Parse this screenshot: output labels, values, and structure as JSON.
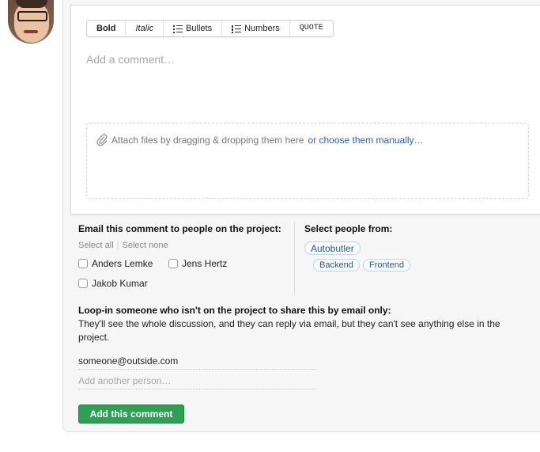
{
  "toolbar": {
    "bold": "Bold",
    "italic": "Italic",
    "bullets": "Bullets",
    "numbers": "Numbers",
    "quote": "QUOTE"
  },
  "editor": {
    "placeholder": "Add a comment…",
    "attach_text": "Attach files by dragging & dropping them here",
    "attach_link": "or choose them manually…"
  },
  "email_section": {
    "heading": "Email this comment to people on the project:",
    "select_all": "Select all",
    "select_none": "Select none",
    "people": [
      {
        "name": "Anders Lemke",
        "checked": false
      },
      {
        "name": "Jens Hertz",
        "checked": false
      },
      {
        "name": "Jakob Kumar",
        "checked": false
      }
    ]
  },
  "select_from": {
    "heading": "Select people from:",
    "groups": [
      "Autobutler",
      "Backend",
      "Frontend"
    ]
  },
  "loopin": {
    "heading": "Loop-in someone who isn't on the project to share this by email only:",
    "description": "They'll see the whole discussion, and they can reply via email, but they can't see anything else in the project.",
    "email_value": "someone@outside.com",
    "add_placeholder": "Add another person…"
  },
  "submit_label": "Add this comment",
  "colors": {
    "submit_green": "#2e9f55",
    "link_blue": "#2a6496",
    "card_bg": "#f6f6f6"
  }
}
